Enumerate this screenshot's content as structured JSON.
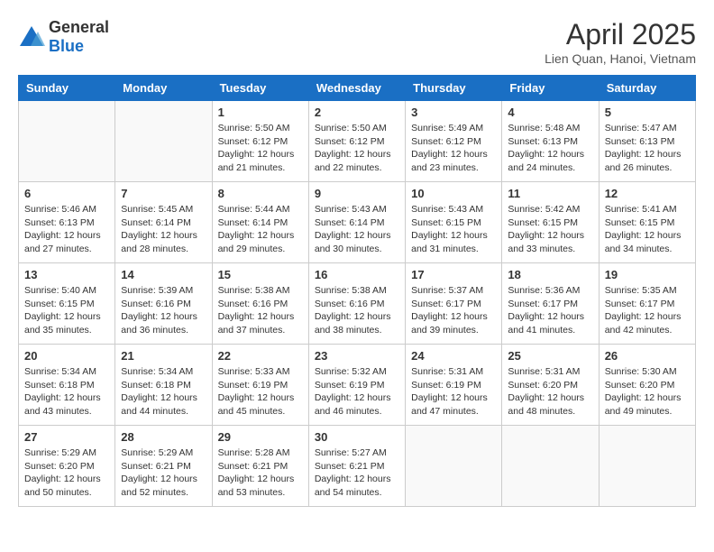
{
  "header": {
    "logo": {
      "general": "General",
      "blue": "Blue"
    },
    "title": "April 2025",
    "subtitle": "Lien Quan, Hanoi, Vietnam"
  },
  "days_of_week": [
    "Sunday",
    "Monday",
    "Tuesday",
    "Wednesday",
    "Thursday",
    "Friday",
    "Saturday"
  ],
  "weeks": [
    [
      {
        "day": "",
        "info": ""
      },
      {
        "day": "",
        "info": ""
      },
      {
        "day": "1",
        "info": "Sunrise: 5:50 AM\nSunset: 6:12 PM\nDaylight: 12 hours and 21 minutes."
      },
      {
        "day": "2",
        "info": "Sunrise: 5:50 AM\nSunset: 6:12 PM\nDaylight: 12 hours and 22 minutes."
      },
      {
        "day": "3",
        "info": "Sunrise: 5:49 AM\nSunset: 6:12 PM\nDaylight: 12 hours and 23 minutes."
      },
      {
        "day": "4",
        "info": "Sunrise: 5:48 AM\nSunset: 6:13 PM\nDaylight: 12 hours and 24 minutes."
      },
      {
        "day": "5",
        "info": "Sunrise: 5:47 AM\nSunset: 6:13 PM\nDaylight: 12 hours and 26 minutes."
      }
    ],
    [
      {
        "day": "6",
        "info": "Sunrise: 5:46 AM\nSunset: 6:13 PM\nDaylight: 12 hours and 27 minutes."
      },
      {
        "day": "7",
        "info": "Sunrise: 5:45 AM\nSunset: 6:14 PM\nDaylight: 12 hours and 28 minutes."
      },
      {
        "day": "8",
        "info": "Sunrise: 5:44 AM\nSunset: 6:14 PM\nDaylight: 12 hours and 29 minutes."
      },
      {
        "day": "9",
        "info": "Sunrise: 5:43 AM\nSunset: 6:14 PM\nDaylight: 12 hours and 30 minutes."
      },
      {
        "day": "10",
        "info": "Sunrise: 5:43 AM\nSunset: 6:15 PM\nDaylight: 12 hours and 31 minutes."
      },
      {
        "day": "11",
        "info": "Sunrise: 5:42 AM\nSunset: 6:15 PM\nDaylight: 12 hours and 33 minutes."
      },
      {
        "day": "12",
        "info": "Sunrise: 5:41 AM\nSunset: 6:15 PM\nDaylight: 12 hours and 34 minutes."
      }
    ],
    [
      {
        "day": "13",
        "info": "Sunrise: 5:40 AM\nSunset: 6:15 PM\nDaylight: 12 hours and 35 minutes."
      },
      {
        "day": "14",
        "info": "Sunrise: 5:39 AM\nSunset: 6:16 PM\nDaylight: 12 hours and 36 minutes."
      },
      {
        "day": "15",
        "info": "Sunrise: 5:38 AM\nSunset: 6:16 PM\nDaylight: 12 hours and 37 minutes."
      },
      {
        "day": "16",
        "info": "Sunrise: 5:38 AM\nSunset: 6:16 PM\nDaylight: 12 hours and 38 minutes."
      },
      {
        "day": "17",
        "info": "Sunrise: 5:37 AM\nSunset: 6:17 PM\nDaylight: 12 hours and 39 minutes."
      },
      {
        "day": "18",
        "info": "Sunrise: 5:36 AM\nSunset: 6:17 PM\nDaylight: 12 hours and 41 minutes."
      },
      {
        "day": "19",
        "info": "Sunrise: 5:35 AM\nSunset: 6:17 PM\nDaylight: 12 hours and 42 minutes."
      }
    ],
    [
      {
        "day": "20",
        "info": "Sunrise: 5:34 AM\nSunset: 6:18 PM\nDaylight: 12 hours and 43 minutes."
      },
      {
        "day": "21",
        "info": "Sunrise: 5:34 AM\nSunset: 6:18 PM\nDaylight: 12 hours and 44 minutes."
      },
      {
        "day": "22",
        "info": "Sunrise: 5:33 AM\nSunset: 6:19 PM\nDaylight: 12 hours and 45 minutes."
      },
      {
        "day": "23",
        "info": "Sunrise: 5:32 AM\nSunset: 6:19 PM\nDaylight: 12 hours and 46 minutes."
      },
      {
        "day": "24",
        "info": "Sunrise: 5:31 AM\nSunset: 6:19 PM\nDaylight: 12 hours and 47 minutes."
      },
      {
        "day": "25",
        "info": "Sunrise: 5:31 AM\nSunset: 6:20 PM\nDaylight: 12 hours and 48 minutes."
      },
      {
        "day": "26",
        "info": "Sunrise: 5:30 AM\nSunset: 6:20 PM\nDaylight: 12 hours and 49 minutes."
      }
    ],
    [
      {
        "day": "27",
        "info": "Sunrise: 5:29 AM\nSunset: 6:20 PM\nDaylight: 12 hours and 50 minutes."
      },
      {
        "day": "28",
        "info": "Sunrise: 5:29 AM\nSunset: 6:21 PM\nDaylight: 12 hours and 52 minutes."
      },
      {
        "day": "29",
        "info": "Sunrise: 5:28 AM\nSunset: 6:21 PM\nDaylight: 12 hours and 53 minutes."
      },
      {
        "day": "30",
        "info": "Sunrise: 5:27 AM\nSunset: 6:21 PM\nDaylight: 12 hours and 54 minutes."
      },
      {
        "day": "",
        "info": ""
      },
      {
        "day": "",
        "info": ""
      },
      {
        "day": "",
        "info": ""
      }
    ]
  ]
}
